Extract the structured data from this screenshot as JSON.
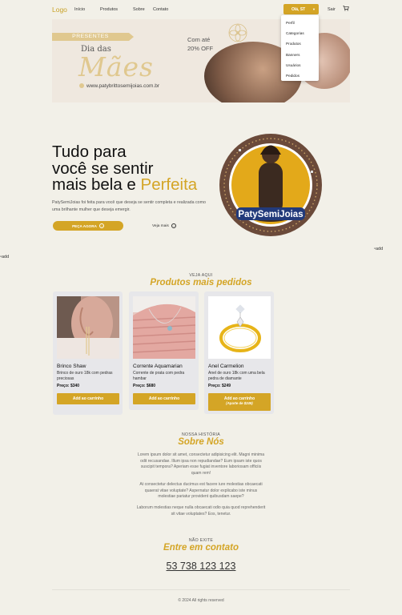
{
  "nav": {
    "logo": "Logo",
    "links": [
      "Início",
      "Produtos",
      "Sobre",
      "Contato"
    ],
    "user_label": "Olá, ST",
    "logout": "Sair"
  },
  "user_menu": [
    "Perfil",
    "Categorias",
    "Produtos",
    "Banners",
    "Usuários",
    "Pedidos"
  ],
  "banner": {
    "tag": "PRESENTES",
    "line1": "Dia das",
    "line2": "Mães",
    "offer_line1": "Com até",
    "offer_line2": "20% OFF",
    "site": "www.patybrittosemijoias.com.br"
  },
  "hero": {
    "title_line1": "Tudo para",
    "title_line2": "você se sentir",
    "title_line3a": "mais bela e ",
    "title_line3b": "Perfeita",
    "description": "PatySemiJoias foi feita para você que deseja se sentir completa e realizada como uma brilhante mulher que deseja emergir.",
    "cta": "PEÇA AGORA",
    "secondary": "Veja mais",
    "badge": "PatySemiJoias"
  },
  "broken_image_alt": "add",
  "products": {
    "kicker": "VEJA AQUI",
    "title": "Produtos mais pedidos",
    "items": [
      {
        "name": "Brinco Shaw",
        "desc": "Brinco de ouro 18k com pedras preciosas",
        "price": "Preço: $340",
        "button": "Add ao carrinho",
        "button_sub": ""
      },
      {
        "name": "Corrente Aquamarian",
        "desc": "Corrente de prata com pedra hambar",
        "price": "Preço: $680",
        "button": "Add ao carrinho",
        "button_sub": ""
      },
      {
        "name": "Anel Carmelion",
        "desc": "Anel de ouro 18k com uma bela pedra de diamante",
        "price": "Preço: $249",
        "button": "Add ao carrinho",
        "button_sub": "(Aparte de $249)"
      }
    ]
  },
  "about": {
    "kicker": "NOSSA HISTÓRIA",
    "title": "Sobre Nós",
    "paragraphs": [
      "Lorem ipsum dolor sit amet, consectetur adipisicing elit. Magni minima odit recusandae. Illum ipsa non repudiandae? Eum ipsam iste quos suscipit tempora? Aperiam esse fugiat inventore laboriosam officiis quam rem!",
      "At consectetur delectus ducimus est facere iure molestias obcaecati quaerat vitae voluptate? Aspernatur dolor explicabo iste minus molestiae pariatur provident quibusdam saepe?",
      "Laborum molestias neque nulla obcaecati odio quia quod reprehenderit sit vitae voluptates? Eos, tenetur."
    ]
  },
  "contact": {
    "kicker": "NÃO EXITE",
    "title": "Entre em contato",
    "phone": "53 738 123 123"
  },
  "footer": "© 2024 All rights reserved",
  "colors": {
    "accent": "#d4a526",
    "background": "#f2f0e8",
    "card": "#e7e7ea",
    "dot_active": "#3a58a8"
  },
  "icons": [
    "cart-icon",
    "arrow-right-icon",
    "caret-down-icon"
  ]
}
